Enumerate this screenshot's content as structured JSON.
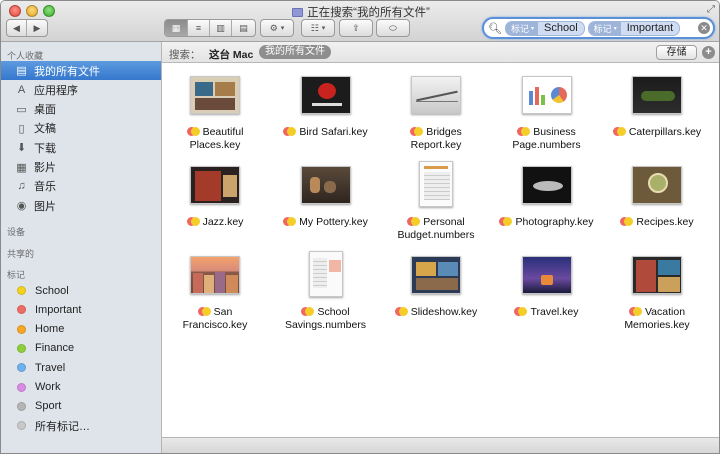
{
  "window": {
    "title": "正在搜索“我的所有文件”"
  },
  "toolbar": {
    "back_glyph": "◀",
    "forward_glyph": "▶",
    "view_icon_glyph": "▦",
    "view_list_glyph": "≡",
    "view_column_glyph": "▥",
    "view_coverflow_glyph": "▤",
    "action_glyph": "⚙",
    "arrange_glyph": "☷",
    "share_glyph": "⇪",
    "tag_glyph": "⬭"
  },
  "search": {
    "tokens": [
      {
        "kind": "标记",
        "value": "School"
      },
      {
        "kind": "标记",
        "value": "Important"
      }
    ]
  },
  "sidebar": {
    "favorites_header": "个人收藏",
    "favorites": [
      {
        "label": "我的所有文件",
        "icon": "all-files-icon",
        "glyph": "▤",
        "selected": true
      },
      {
        "label": "应用程序",
        "icon": "applications-icon",
        "glyph": "A",
        "selected": false
      },
      {
        "label": "桌面",
        "icon": "desktop-icon",
        "glyph": "▭",
        "selected": false
      },
      {
        "label": "文稿",
        "icon": "documents-icon",
        "glyph": "▯",
        "selected": false
      },
      {
        "label": "下载",
        "icon": "downloads-icon",
        "glyph": "⬇",
        "selected": false
      },
      {
        "label": "影片",
        "icon": "movies-icon",
        "glyph": "▦",
        "selected": false
      },
      {
        "label": "音乐",
        "icon": "music-icon",
        "glyph": "♫",
        "selected": false
      },
      {
        "label": "图片",
        "icon": "pictures-icon",
        "glyph": "◉",
        "selected": false
      }
    ],
    "devices_header": "设备",
    "shared_header": "共享的",
    "tags_header": "标记",
    "tags": [
      {
        "label": "School",
        "color": "#f2d21e"
      },
      {
        "label": "Important",
        "color": "#ef6b65"
      },
      {
        "label": "Home",
        "color": "#f6a623"
      },
      {
        "label": "Finance",
        "color": "#8ccf3a"
      },
      {
        "label": "Travel",
        "color": "#6fb1ee"
      },
      {
        "label": "Work",
        "color": "#d98ce6"
      },
      {
        "label": "Sport",
        "color": "#b5b5b5"
      },
      {
        "label": "所有标记…",
        "color": "#c8c8c8"
      }
    ]
  },
  "scopebar": {
    "search_label": "搜索：",
    "this_mac": "这台 Mac",
    "all_my_files": "我的所有文件",
    "save_label": "存储",
    "add_glyph": "+"
  },
  "files": [
    {
      "name": "Beautiful Places.key",
      "line1": "Beautiful",
      "line2": "Places.key",
      "thumb": "beautiful"
    },
    {
      "name": "Bird Safari.key",
      "line1": "Bird Safari.key",
      "line2": "",
      "thumb": "bird"
    },
    {
      "name": "Bridges Report.key",
      "line1": "Bridges",
      "line2": "Report.key",
      "thumb": "bridges"
    },
    {
      "name": "Business Page.numbers",
      "line1": "Business",
      "line2": "Page.numbers",
      "thumb": "business"
    },
    {
      "name": "Caterpillars.key",
      "line1": "Caterpillars.key",
      "line2": "",
      "thumb": "caterpillars"
    },
    {
      "name": "Jazz.key",
      "line1": "Jazz.key",
      "line2": "",
      "thumb": "jazz"
    },
    {
      "name": "My Pottery.key",
      "line1": "My Pottery.key",
      "line2": "",
      "thumb": "pottery"
    },
    {
      "name": "Personal Budget.numbers",
      "line1": "Personal",
      "line2": "Budget.numbers",
      "thumb": "budget"
    },
    {
      "name": "Photography.key",
      "line1": "Photography.key",
      "line2": "",
      "thumb": "photography"
    },
    {
      "name": "Recipes.key",
      "line1": "Recipes.key",
      "line2": "",
      "thumb": "recipes"
    },
    {
      "name": "San Francisco.key",
      "line1": "San",
      "line2": "Francisco.key",
      "thumb": "sanfrancisco"
    },
    {
      "name": "School Savings.numbers",
      "line1": "School",
      "line2": "Savings.numbers",
      "thumb": "savings"
    },
    {
      "name": "Slideshow.key",
      "line1": "Slideshow.key",
      "line2": "",
      "thumb": "slideshow"
    },
    {
      "name": "Travel.key",
      "line1": "Travel.key",
      "line2": "",
      "thumb": "travel"
    },
    {
      "name": "Vacation Memories.key",
      "line1": "Vacation",
      "line2": "Memories.key",
      "thumb": "vacation"
    }
  ]
}
